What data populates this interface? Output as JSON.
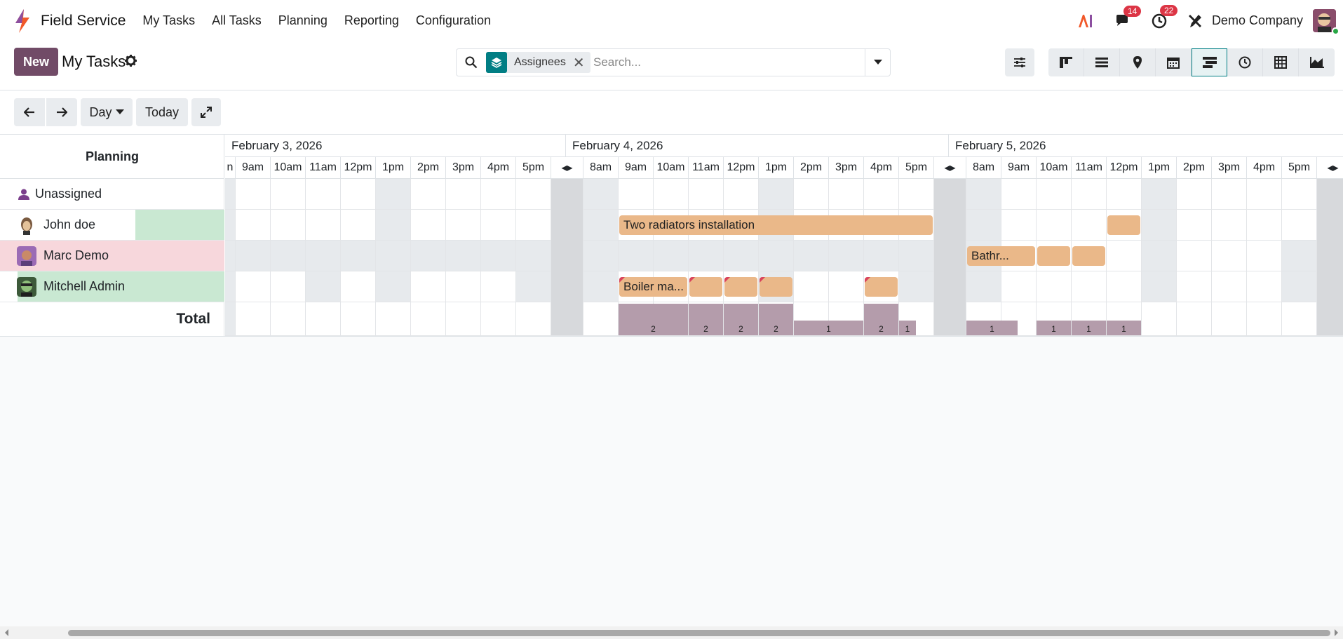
{
  "nav": {
    "app_name": "Field Service",
    "menus": [
      "My Tasks",
      "All Tasks",
      "Planning",
      "Reporting",
      "Configuration"
    ],
    "messages_count": "14",
    "activities_count": "22",
    "company": "Demo Company",
    "colors": {
      "brand_orange": "#f1592a",
      "brand_purple": "#714b67"
    }
  },
  "control": {
    "new_label": "New",
    "title": "My Tasks",
    "facet_label": "Assignees",
    "search_placeholder": "Search...",
    "views": [
      "kanban-icon",
      "list-icon",
      "map-pin-icon",
      "calendar-icon",
      "gantt-icon",
      "clock-icon",
      "pivot-icon",
      "graph-icon"
    ],
    "active_view": "gantt-icon"
  },
  "toolbar": {
    "scale_label": "Day",
    "today_label": "Today"
  },
  "gantt": {
    "planning_title": "Planning",
    "dates": [
      "February 3, 2026",
      "February 4, 2026",
      "February 5, 2026"
    ],
    "day1_hours": [
      "n",
      "9am",
      "10am",
      "11am",
      "12pm",
      "1pm",
      "2pm",
      "3pm",
      "4pm",
      "5pm"
    ],
    "day2_hours": [
      "8am",
      "9am",
      "10am",
      "11am",
      "12pm",
      "1pm",
      "2pm",
      "3pm",
      "4pm",
      "5pm"
    ],
    "day3_hours": [
      "8am",
      "9am",
      "10am",
      "11am",
      "12pm",
      "1pm",
      "2pm",
      "3pm",
      "4pm",
      "5pm"
    ],
    "rows": [
      {
        "name": "Unassigned"
      },
      {
        "name": "John doe"
      },
      {
        "name": "Marc Demo"
      },
      {
        "name": "Mitchell Admin"
      }
    ],
    "total_label": "Total",
    "pills": {
      "john_radiators": "Two radiators installation",
      "marc_bathroom": "Bathr...",
      "mitchell_boiler": "Boiler ma..."
    },
    "totals": [
      "2",
      "2",
      "2",
      "2",
      "1",
      "2",
      "1",
      "1",
      "1",
      "1",
      "1"
    ],
    "colors": {
      "pill": "#eab889",
      "total_bar": "#b49cab",
      "row_highlight_green": "#c9e8d2",
      "row_highlight_red": "#f7d7dc"
    }
  }
}
